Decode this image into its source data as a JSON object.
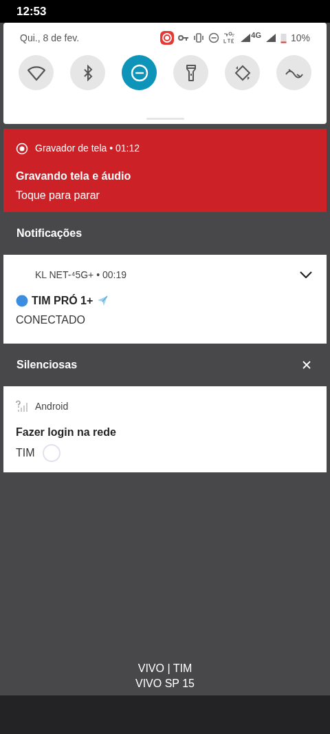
{
  "status_bar": {
    "time": "12:53"
  },
  "quick_settings": {
    "date": "Qui., 8 de fev.",
    "battery": "10%",
    "network": "4G",
    "tiles": [
      {
        "kind": "wifi",
        "on": false
      },
      {
        "kind": "bluetooth",
        "on": false
      },
      {
        "kind": "dnd",
        "on": true
      },
      {
        "kind": "flashlight",
        "on": false
      },
      {
        "kind": "rotate",
        "on": false
      },
      {
        "kind": "data_saver",
        "on": false
      }
    ]
  },
  "recording": {
    "app": "Gravador de tela • 01:12",
    "title": "Gravando tela e áudio",
    "text": "Toque para parar"
  },
  "sections": [
    {
      "header": "Notificações",
      "dismissible": false,
      "notifications": [
        {
          "app": "KL NET-⁴5G+ • 00:19",
          "title": "TIM PRÓ 1+",
          "text": "CONECTADO",
          "expandable": true,
          "app_icon": false
        }
      ]
    },
    {
      "header": "Silenciosas",
      "dismissible": true,
      "notifications": [
        {
          "app": "Android",
          "title": "Fazer login na rede",
          "text": "TIM",
          "expandable": false,
          "app_icon": true
        }
      ]
    }
  ],
  "carrier": {
    "line1": "VIVO | TIM",
    "line2": "VIVO SP 15"
  }
}
